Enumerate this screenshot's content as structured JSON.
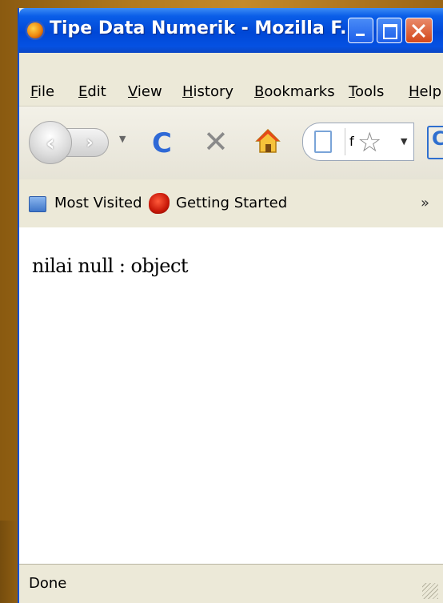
{
  "window": {
    "title": "Tipe Data Numerik - Mozilla F...",
    "buttons": {
      "minimize": "minimize",
      "maximize": "maximize",
      "close": "close"
    }
  },
  "menu": {
    "items": [
      "File",
      "Edit",
      "View",
      "History",
      "Bookmarks",
      "Tools",
      "Help"
    ]
  },
  "toolbar": {
    "back_glyph": "‹",
    "forward_glyph": "›",
    "reload_glyph": "C",
    "stop_glyph": "✕",
    "url_fragment": "f",
    "go_fragment": "C"
  },
  "bookmarks": {
    "items": [
      "Most Visited",
      "Getting Started"
    ],
    "overflow": "»"
  },
  "content": {
    "text": "nilai null : object"
  },
  "status": {
    "text": "Done"
  },
  "colors": {
    "titlebar": "#0551e2",
    "close_button": "#d3481b",
    "reload": "#2f69d6"
  }
}
